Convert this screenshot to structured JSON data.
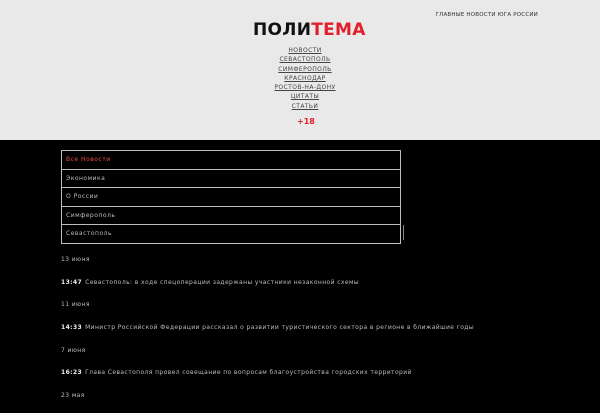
{
  "header": {
    "logo_part1": "ПОЛИ",
    "logo_part2": "ТЕМА",
    "tagline": "ГЛАВНЫЕ НОВОСТИ ЮГА РОССИИ",
    "age_rating": "+18",
    "colors": {
      "background": "#e9e9e9",
      "accent": "#e1202c"
    }
  },
  "nav": {
    "items": [
      {
        "label": "НОВОСТИ"
      },
      {
        "label": "СЕВАСТОПОЛЬ"
      },
      {
        "label": "СИМФЕРОПОЛЬ"
      },
      {
        "label": "КРАСНОДАР"
      },
      {
        "label": "РОСТОВ-НА-ДОНУ"
      },
      {
        "label": "ЦИТАТЫ"
      },
      {
        "label": "СТАТЬИ"
      }
    ]
  },
  "news_table": {
    "rows": [
      {
        "label": "Все Новости"
      },
      {
        "label": "Экономика"
      },
      {
        "label": "О России"
      },
      {
        "label": "Симферополь"
      },
      {
        "label": "Севастополь"
      }
    ]
  },
  "feed": [
    {
      "type": "date",
      "text": "13 июня"
    },
    {
      "type": "item",
      "time": "13:47",
      "text": "Севастополь: в ходе спецоперации задержаны участники незаконной схемы"
    },
    {
      "type": "date",
      "text": "11 июня"
    },
    {
      "type": "item",
      "time": "14:33",
      "text": "Министр Российской Федерации рассказал о развитии туристического сектора в регионе в ближайшие годы"
    },
    {
      "type": "date",
      "text": "7 июня"
    },
    {
      "type": "item",
      "time": "16:23",
      "text": "Глава Севастополя провел совещание по вопросам благоустройства городских территорий"
    },
    {
      "type": "date",
      "text": "23 мая"
    }
  ]
}
